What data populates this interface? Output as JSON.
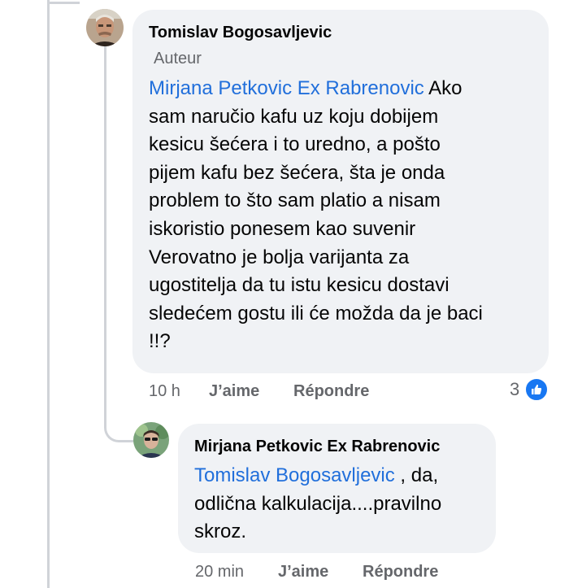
{
  "comment": {
    "author": "Tomislav Bogosavljevic",
    "badge": "Auteur",
    "mention": "Mirjana Petkovic Ex Rabrenovic",
    "lines": [
      " Ako",
      "sam naručio kafu uz koju dobijem",
      "kesicu šećera i to uredno, a pošto",
      "pijem kafu bez šećera, šta je onda",
      "problem to što sam platio a nisam",
      "iskoristio ponesem kao suvenir",
      "Verovatno je bolja varijanta za",
      "ugostitelja da tu istu kesicu dostavi",
      "sledećem gostu ili će možda da je baci",
      "!!?"
    ],
    "time": "10 h",
    "like_label": "J’aime",
    "reply_label": "Répondre",
    "reaction_count": "3",
    "reaction_icon": "thumbs-up-icon",
    "reaction_color": "#1877f2"
  },
  "reply": {
    "author": "Mirjana Petkovic Ex Rabrenovic",
    "mention": "Tomislav Bogosavljevic",
    "lines": [
      " , da,",
      "odlična kalkulacija....pravilno",
      "skroz."
    ],
    "time": "20 min",
    "like_label": "J’aime",
    "reply_label": "Répondre"
  },
  "colors": {
    "bubble": "#f0f2f5",
    "mention": "#216fdb",
    "muted": "#65676b"
  }
}
